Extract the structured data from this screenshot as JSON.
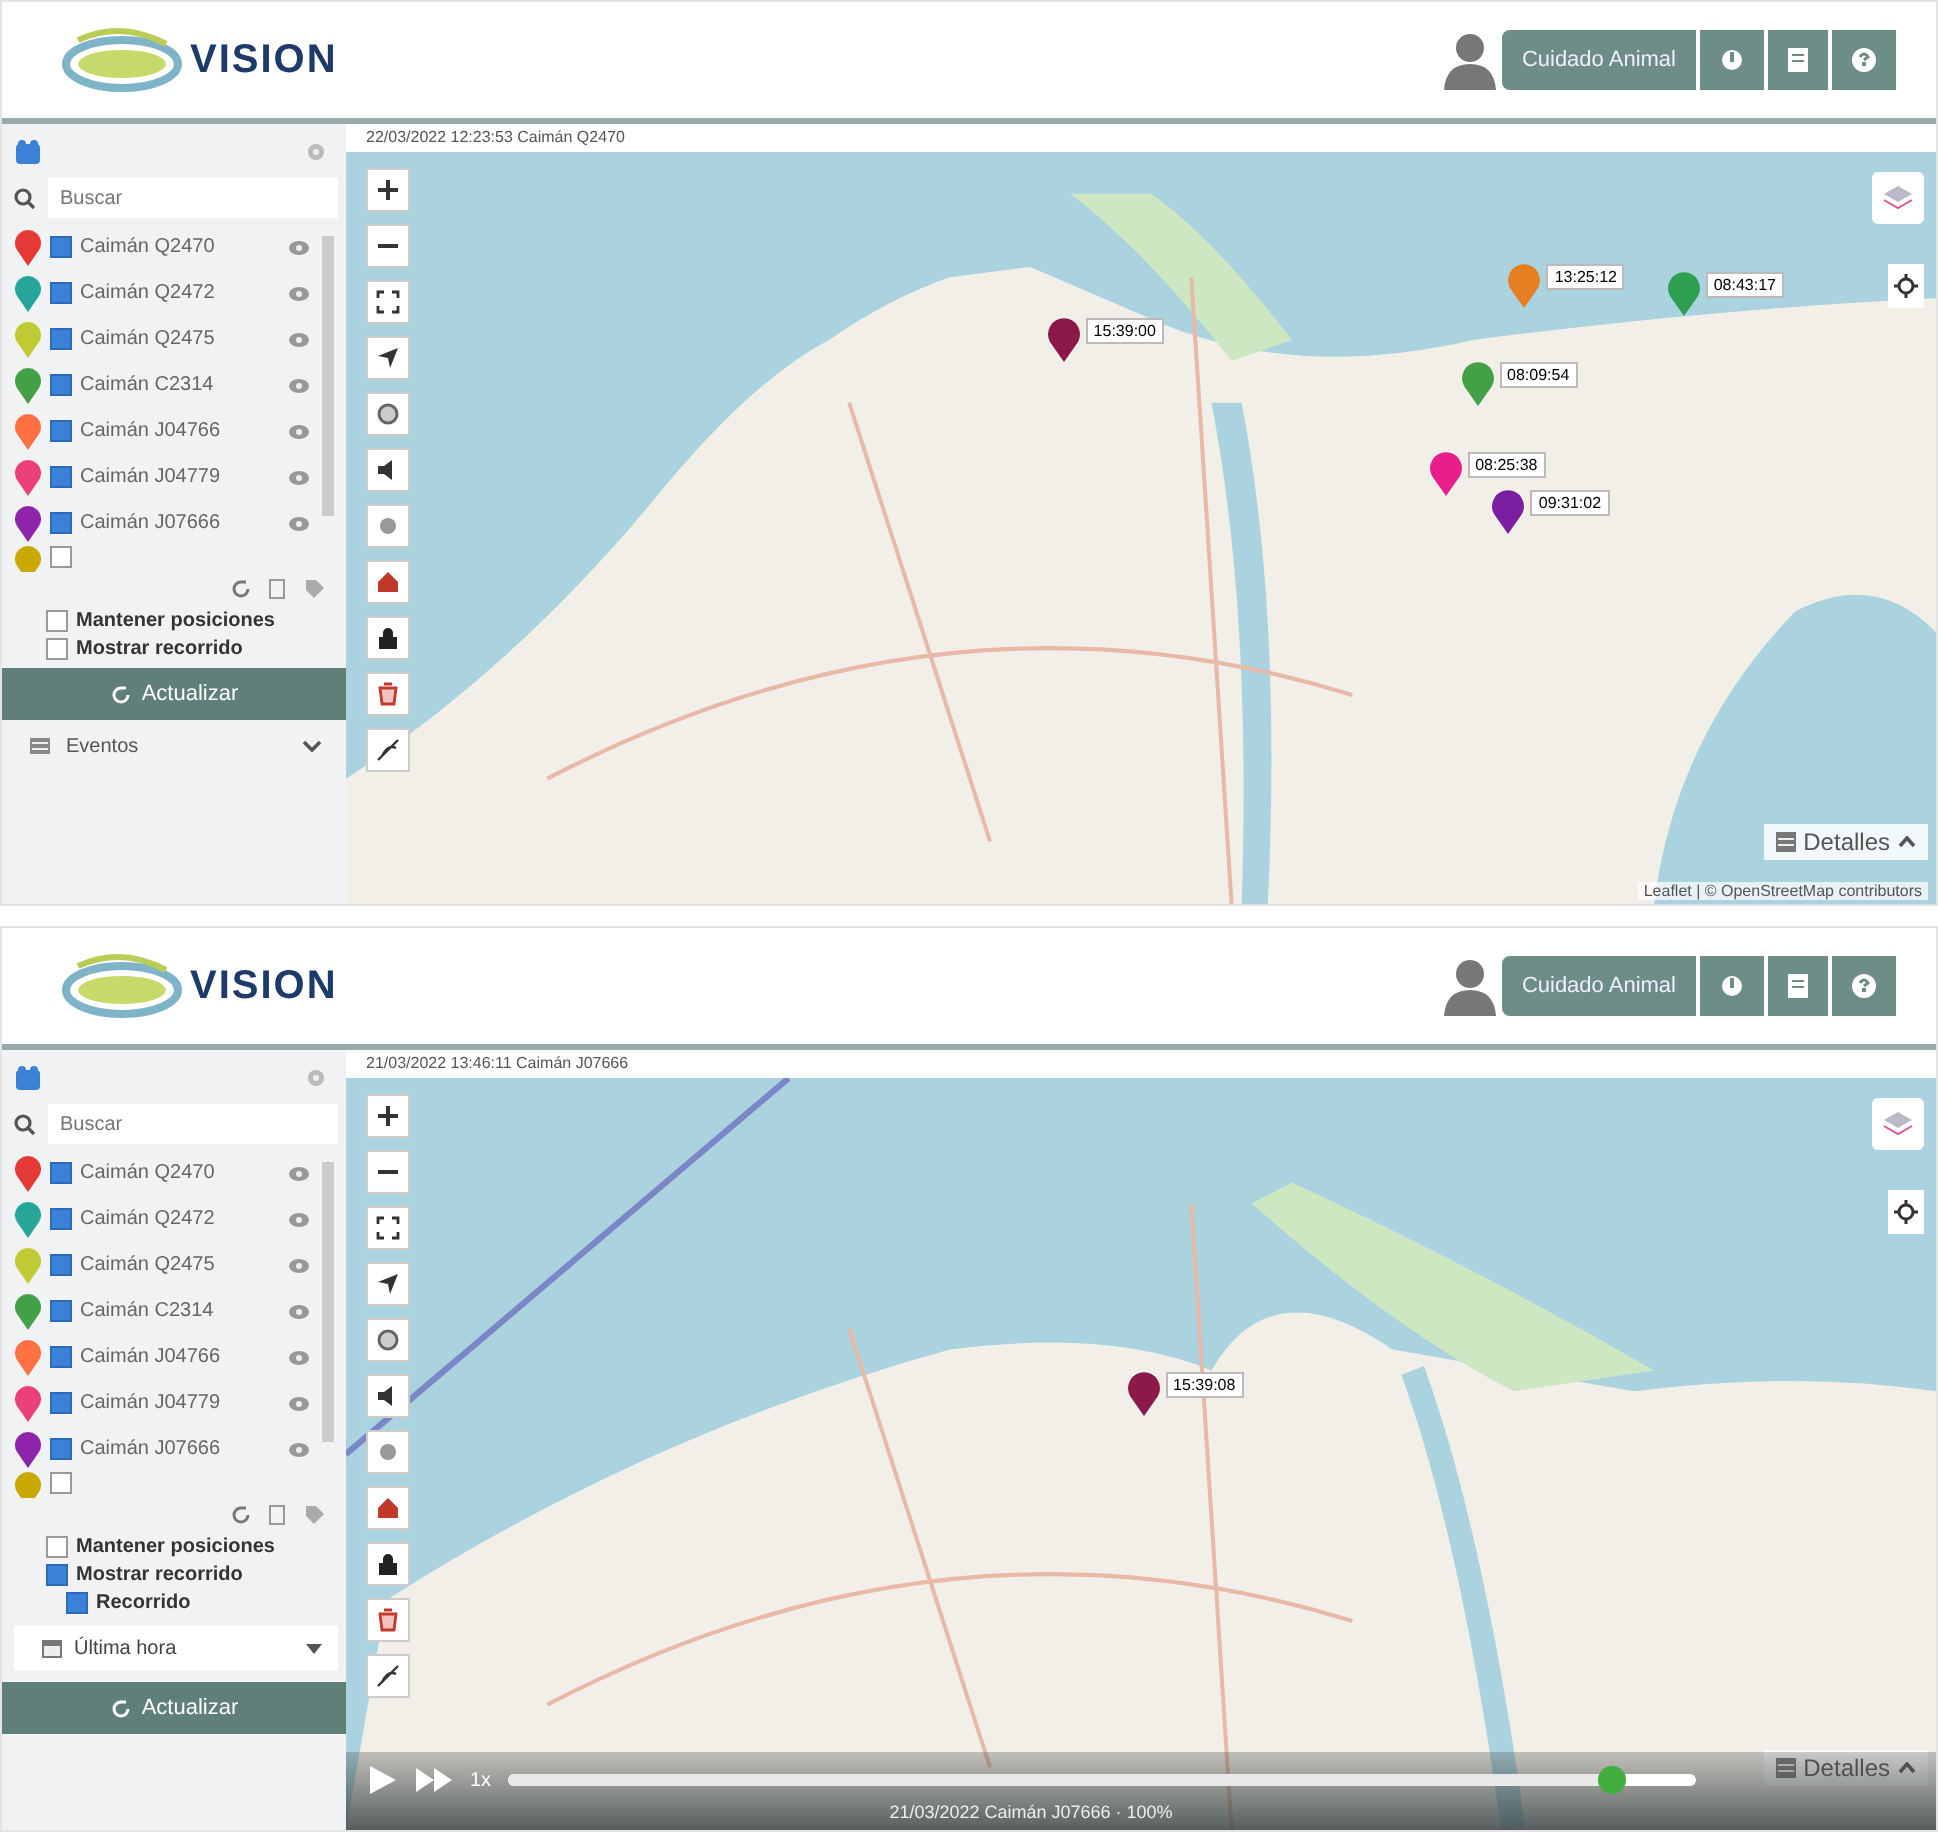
{
  "screens": [
    {
      "logo": {
        "text": "VISION"
      },
      "header": {
        "user": "Cuidado Animal"
      },
      "sidebar": {
        "search_placeholder": "Buscar",
        "animals": [
          {
            "name": "Caimán Q2470",
            "color": "#e53935",
            "checked": true
          },
          {
            "name": "Caimán Q2472",
            "color": "#26a69a",
            "checked": true
          },
          {
            "name": "Caimán Q2475",
            "color": "#c0ca33",
            "checked": true
          },
          {
            "name": "Caimán C2314",
            "color": "#43a047",
            "checked": true
          },
          {
            "name": "Caimán J04766",
            "color": "#ff7043",
            "checked": true
          },
          {
            "name": "Caimán J04779",
            "color": "#ec407a",
            "checked": true
          },
          {
            "name": "Caimán J07666",
            "color": "#8e24aa",
            "checked": true
          },
          {
            "color": "#c9a800",
            "checked": false
          }
        ],
        "options": [
          {
            "kind": "main",
            "label": "Mantener posiciones",
            "checked": false
          },
          {
            "kind": "main",
            "label": "Mostrar recorrido",
            "checked": false
          }
        ],
        "refresh": "Actualizar",
        "section": "Eventos"
      },
      "map": {
        "status": "22/03/2022 12:23:53 Caimán Q2470",
        "markers": [
          {
            "label": "15:39:00",
            "color": "#8b1a4a"
          },
          {
            "label": "13:25:12",
            "color": "#e67e22"
          },
          {
            "label": "08:43:17",
            "color": "#2e9e4f"
          },
          {
            "label": "08:09:54",
            "color": "#43a047"
          },
          {
            "label": "08:25:38",
            "color": "#e91e8c"
          },
          {
            "label": "09:31:02",
            "color": "#7b1fa2"
          }
        ],
        "details": "Detalles",
        "attribution": "Leaflet | © OpenStreetMap contributors"
      }
    },
    {
      "logo": {
        "text": "VISION"
      },
      "header": {
        "user": "Cuidado Animal"
      },
      "sidebar": {
        "search_placeholder": "Buscar",
        "animals": [
          {
            "name": "Caimán Q2470",
            "color": "#e53935",
            "checked": true
          },
          {
            "name": "Caimán Q2472",
            "color": "#26a69a",
            "checked": true
          },
          {
            "name": "Caimán Q2475",
            "color": "#c0ca33",
            "checked": true
          },
          {
            "name": "Caimán C2314",
            "color": "#43a047",
            "checked": true
          },
          {
            "name": "Caimán J04766",
            "color": "#ff7043",
            "checked": true
          },
          {
            "name": "Caimán J04779",
            "color": "#ec407a",
            "checked": true
          },
          {
            "name": "Caimán J07666",
            "color": "#8e24aa",
            "checked": true
          },
          {
            "color": "#c9a800",
            "checked": false
          }
        ],
        "options": [
          {
            "kind": "main",
            "label": "Mantener posiciones",
            "checked": false
          },
          {
            "kind": "main",
            "label": "Mostrar recorrido",
            "checked": true
          },
          {
            "kind": "sub",
            "label": "Recorrido",
            "checked": true
          }
        ],
        "period": "Última hora",
        "refresh": "Actualizar"
      },
      "map": {
        "status": "21/03/2022 13:46:11 Caimán J07666",
        "markers": [
          {
            "label": "15:39:08",
            "color": "#8b1a4a"
          }
        ],
        "details": "Detalles",
        "playback": {
          "speed": "1x",
          "level": 0.93,
          "caption": "21/03/2022 Caimán J07666 · 100%"
        }
      }
    }
  ]
}
